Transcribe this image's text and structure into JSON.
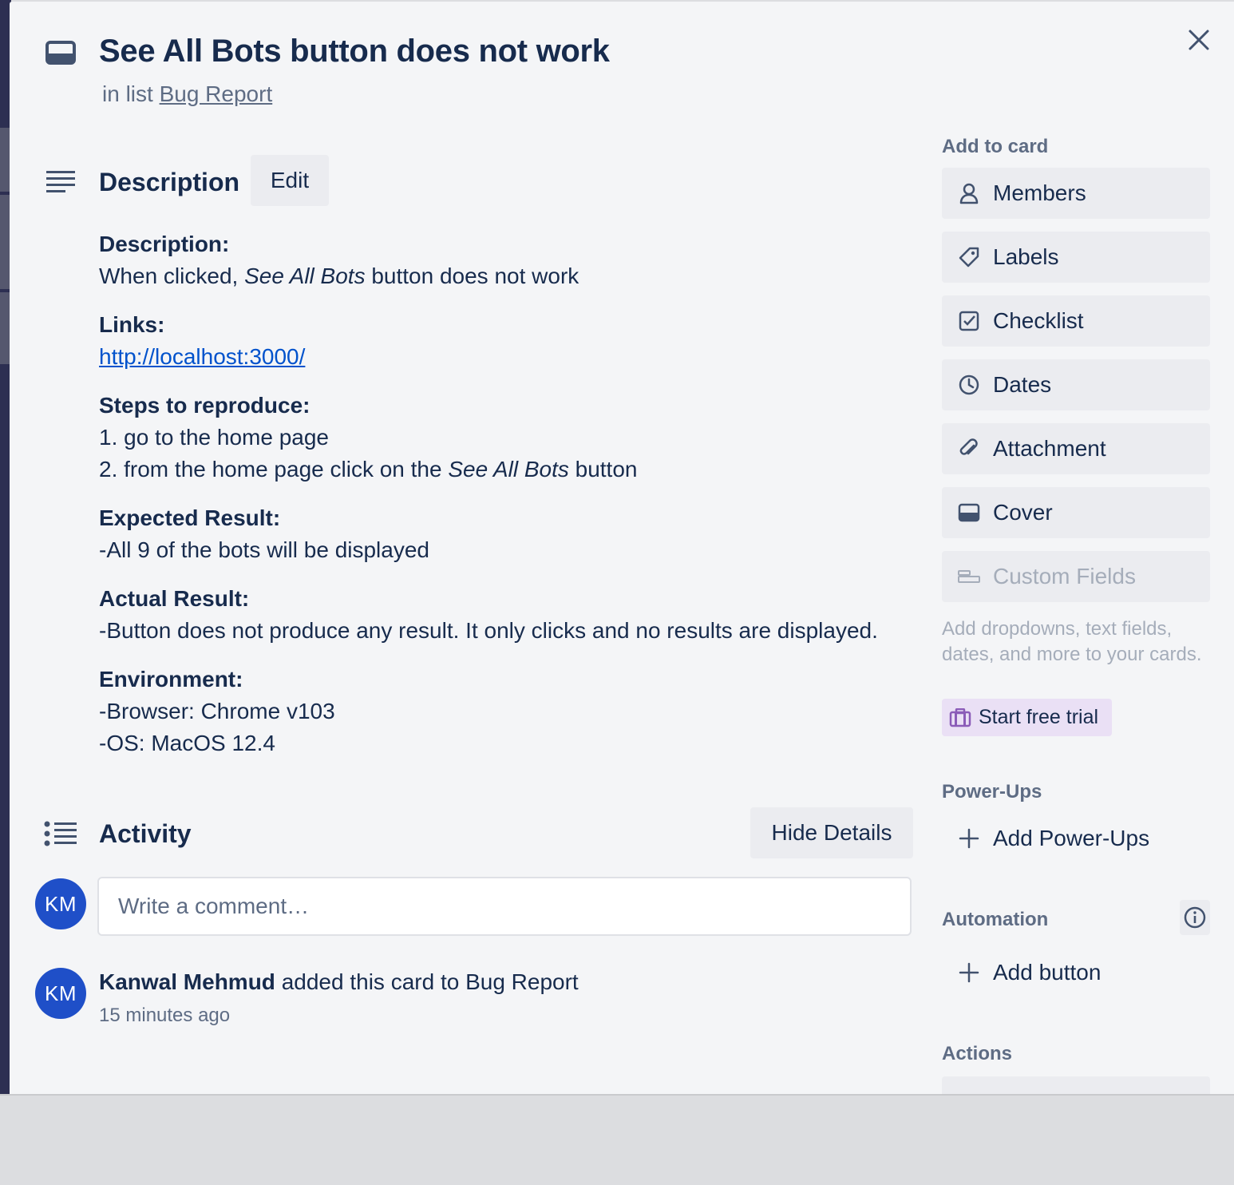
{
  "header": {
    "title": "See All Bots button does not work",
    "in_list_prefix": "in list",
    "list_name": "Bug Report"
  },
  "description": {
    "heading": "Description",
    "edit_label": "Edit",
    "sections": {
      "description": {
        "label": "Description:",
        "text_before": "When clicked, ",
        "text_em": "See All Bots",
        "text_after": " button does not work"
      },
      "links": {
        "label": "Links:",
        "url": "http://localhost:3000/"
      },
      "steps": {
        "label": "Steps to reproduce:",
        "step1": "1. go to the home page",
        "step2_before": "2. from the home page click on the ",
        "step2_em": "See All Bots",
        "step2_after": " button"
      },
      "expected": {
        "label": "Expected Result:",
        "text": "-All 9 of the bots will be displayed"
      },
      "actual": {
        "label": "Actual Result:",
        "text": "-Button does not produce any result. It only clicks and no results are displayed."
      },
      "environment": {
        "label": "Environment:",
        "browser": "-Browser: Chrome v103",
        "os": "-OS: MacOS 12.4"
      }
    }
  },
  "activity": {
    "heading": "Activity",
    "hide_details_label": "Hide Details",
    "comment_placeholder": "Write a comment…",
    "user_initials": "KM",
    "entries": [
      {
        "initials": "KM",
        "actor": "Kanwal Mehmud",
        "action": " added this card to Bug Report",
        "time": "15 minutes ago"
      }
    ]
  },
  "sidebar": {
    "add_to_card_label": "Add to card",
    "buttons": [
      {
        "label": "Members",
        "icon": "person-icon"
      },
      {
        "label": "Labels",
        "icon": "tag-icon"
      },
      {
        "label": "Checklist",
        "icon": "checkbox-icon"
      },
      {
        "label": "Dates",
        "icon": "clock-icon"
      },
      {
        "label": "Attachment",
        "icon": "paperclip-icon"
      },
      {
        "label": "Cover",
        "icon": "cover-icon"
      },
      {
        "label": "Custom Fields",
        "icon": "custom-fields-icon"
      }
    ],
    "custom_fields_help": "Add dropdowns, text fields, dates, and more to your cards.",
    "start_trial_label": "Start free trial",
    "powerups_label": "Power-Ups",
    "add_powerups_label": "Add Power-Ups",
    "automation_label": "Automation",
    "add_button_label": "Add button",
    "actions_label": "Actions"
  },
  "colors": {
    "modal_bg": "#f4f5f7",
    "button_bg": "#ebecf0",
    "text": "#172b4d",
    "muted": "#5e6c84",
    "link": "#0052cc",
    "avatar": "#1f4fc8",
    "trial_bg": "#eae0f5"
  }
}
